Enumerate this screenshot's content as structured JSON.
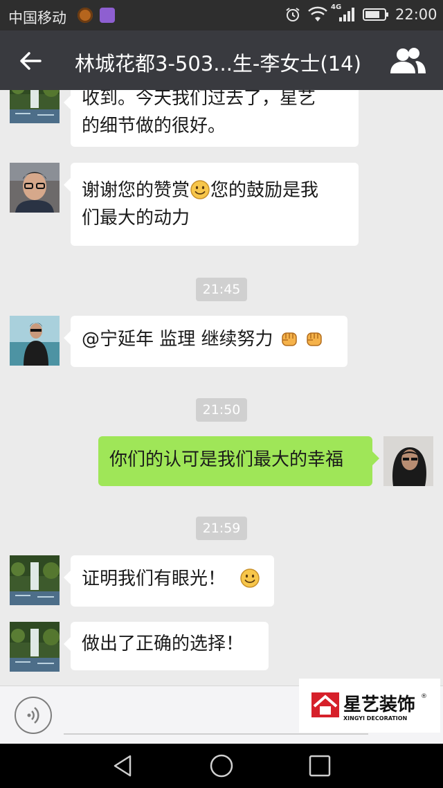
{
  "status": {
    "carrier": "中国移动",
    "network": "4G",
    "time": "22:00"
  },
  "header": {
    "title": "林城花都3-503...生-李女士(14)",
    "back_icon": "arrow-left-icon",
    "members_icon": "group-icon"
  },
  "messages": [
    {
      "type": "left",
      "avatar": "waterfall",
      "text_lines": [
        "收到。今天我们过去了，星艺",
        "的细节做的很好。"
      ]
    },
    {
      "type": "left",
      "avatar": "man-glasses",
      "text_lines": [
        "谢谢您的赞赏",
        "您的鼓励是我",
        "们最大的动力"
      ]
    },
    {
      "type": "time",
      "text": "21:45"
    },
    {
      "type": "left",
      "avatar": "man-sea",
      "text": "@宁延年 监理 继续努力"
    },
    {
      "type": "time",
      "text": "21:50"
    },
    {
      "type": "right",
      "avatar": "woman",
      "text": "你们的认可是我们最大的幸福"
    },
    {
      "type": "time",
      "text": "21:59"
    },
    {
      "type": "left",
      "avatar": "waterfall",
      "text": "证明我们有眼光！"
    },
    {
      "type": "left",
      "avatar": "waterfall",
      "text": "做出了正确的选择！"
    }
  ],
  "watermark": {
    "brand": "星艺装饰",
    "sub": "XINGYI DECORATION",
    "mark": "®"
  },
  "nav": {
    "icons": [
      "back-triangle-icon",
      "home-circle-icon",
      "recents-square-icon"
    ]
  },
  "colors": {
    "accent_green": "#9fe658",
    "title_bg": "#393a3f",
    "chat_bg": "#ebebeb"
  }
}
